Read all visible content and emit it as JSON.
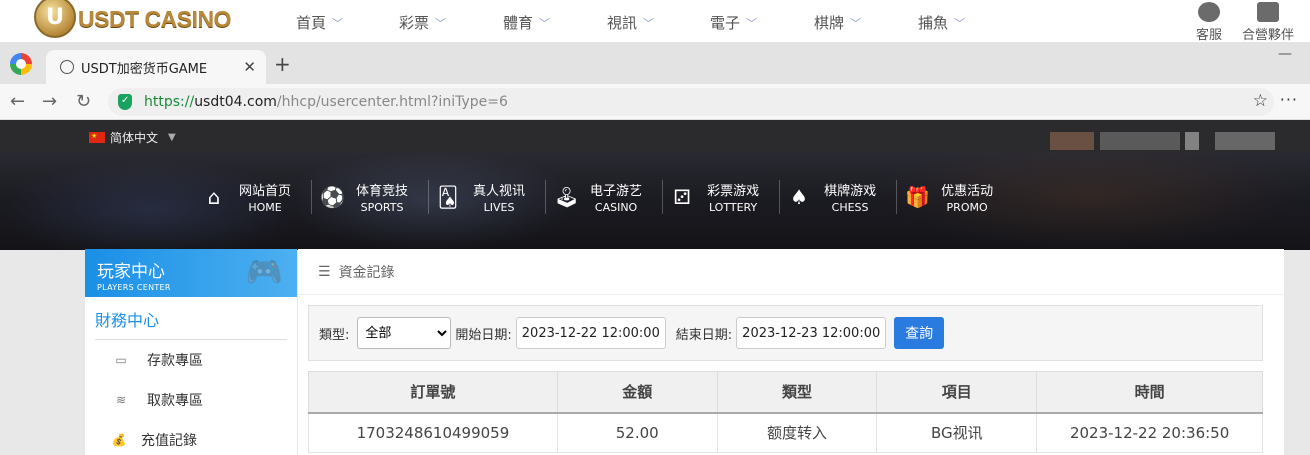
{
  "top_nav": {
    "logo_text": "USDT CASINO",
    "logo_letter": "U",
    "menu": [
      "首頁",
      "彩票",
      "體育",
      "視訊",
      "電子",
      "棋牌",
      "捕魚"
    ],
    "right": [
      "客服",
      "合營夥伴"
    ]
  },
  "browser": {
    "tab_title": "USDT加密货币GAME",
    "url_scheme": "https://",
    "url_host": "usdt04.com",
    "url_path": "/hhcp/usercenter.html?iniType=6"
  },
  "lang": {
    "label": "简体中文"
  },
  "main_nav": [
    {
      "cn": "网站首页",
      "en": "HOME",
      "icon": "home-icon"
    },
    {
      "cn": "体育竞技",
      "en": "SPORTS",
      "icon": "ball-icon"
    },
    {
      "cn": "真人视讯",
      "en": "LIVES",
      "icon": "cards-icon"
    },
    {
      "cn": "电子游艺",
      "en": "CASINO",
      "icon": "joystick-icon"
    },
    {
      "cn": "彩票游戏",
      "en": "LOTTERY",
      "icon": "dice-icon"
    },
    {
      "cn": "棋牌游戏",
      "en": "CHESS",
      "icon": "spade-icon"
    },
    {
      "cn": "优惠活动",
      "en": "PROMO",
      "icon": "gift-icon"
    }
  ],
  "sidebar": {
    "title_cn": "玩家中心",
    "title_en": "PLAYERS CENTER",
    "section": "財務中心",
    "items": [
      {
        "label": "存款專區",
        "icon": "card-icon"
      },
      {
        "label": "取款專區",
        "icon": "cash-icon"
      },
      {
        "label": "充值記錄",
        "icon": "moneybag-icon"
      }
    ]
  },
  "panel": {
    "title": "資金記錄",
    "filter": {
      "type_label": "類型:",
      "type_value": "全部",
      "start_label": "開始日期:",
      "start_value": "2023-12-22 12:00:00",
      "end_label": "結束日期:",
      "end_value": "2023-12-23 12:00:00",
      "query_button": "查詢"
    },
    "table": {
      "headers": [
        "訂單號",
        "金額",
        "類型",
        "項目",
        "時間"
      ],
      "rows": [
        [
          "1703248610499059",
          "52.00",
          "额度转入",
          "BG视讯",
          "2023-12-22 20:36:50"
        ]
      ]
    }
  }
}
